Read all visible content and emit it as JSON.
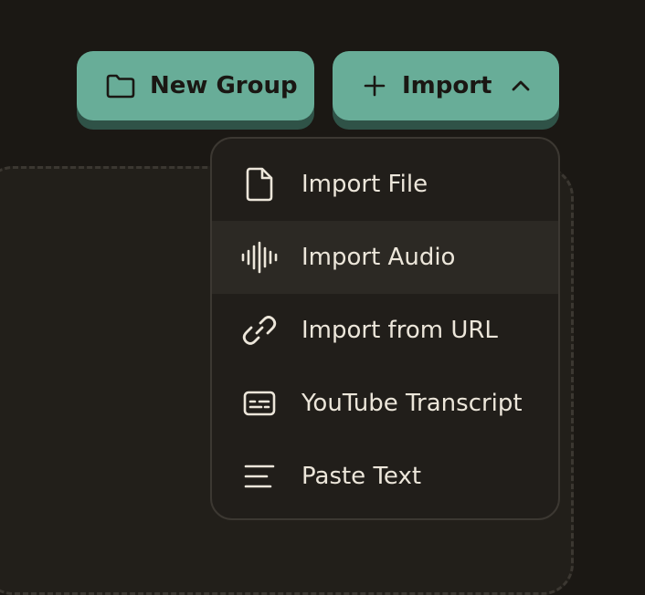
{
  "toolbar": {
    "new_group_label": "New Group",
    "import_label": "Import"
  },
  "import_menu": {
    "items": [
      {
        "label": "Import File",
        "icon": "file-icon"
      },
      {
        "label": "Import Audio",
        "icon": "audio-waveform-icon"
      },
      {
        "label": "Import from URL",
        "icon": "link-icon"
      },
      {
        "label": "YouTube Transcript",
        "icon": "captions-icon"
      },
      {
        "label": "Paste Text",
        "icon": "text-lines-icon"
      }
    ],
    "highlighted_index": 1
  },
  "colors": {
    "background": "#1b1814",
    "button": "#68ad98",
    "button_shadow": "#2f5247",
    "menu_bg": "#211e1a",
    "menu_hover": "#2c2924",
    "text": "#ece6da"
  }
}
